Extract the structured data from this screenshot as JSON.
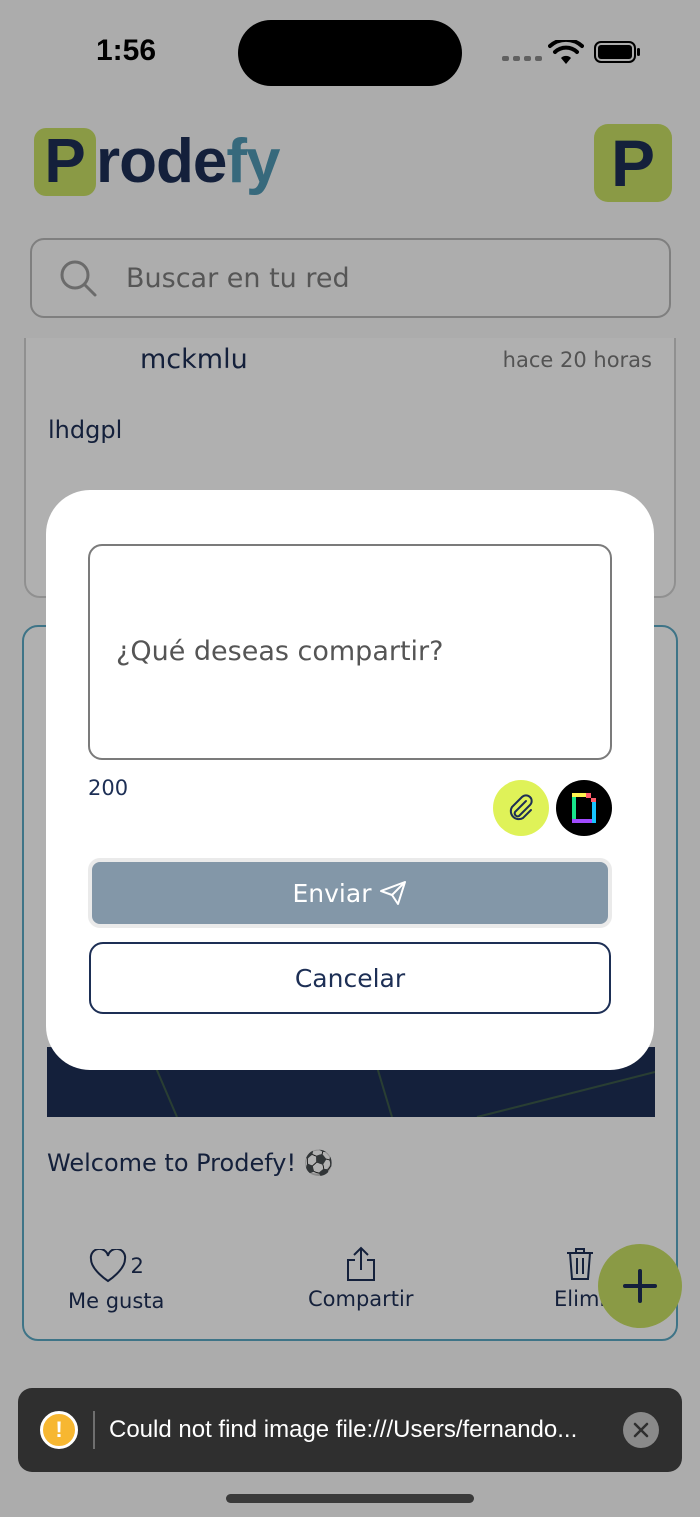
{
  "status_bar": {
    "time": "1:56"
  },
  "header": {
    "logo_letter": "P",
    "logo_rest": "rode",
    "logo_accent": "fy",
    "avatar_letter": "P"
  },
  "search": {
    "placeholder": "Buscar en tu red"
  },
  "feed": {
    "posts": [
      {
        "username": "mckmlu",
        "timestamp": "hace 20 horas",
        "body": "lhdgpl"
      },
      {
        "caption": "Welcome to Prodefy! ⚽",
        "likes": "2",
        "like_label": "Me gusta",
        "share_label": "Compartir",
        "delete_label": "Elimi"
      }
    ]
  },
  "modal": {
    "input_placeholder": "¿Qué deseas compartir?",
    "char_count": "200",
    "send_label": "Enviar",
    "cancel_label": "Cancelar"
  },
  "toast": {
    "message": "Could not find image file:///Users/fernando..."
  },
  "colors": {
    "brand_navy": "#1d2f55",
    "brand_lime": "#c6dd63",
    "accent_blue": "#4f97b2",
    "send_disabled": "#8397a8"
  },
  "icons": [
    "search-icon",
    "heart-icon",
    "share-icon",
    "trash-icon",
    "plus-icon",
    "paperclip-icon",
    "gif-icon",
    "send-plane-icon",
    "warning-icon",
    "close-icon"
  ]
}
